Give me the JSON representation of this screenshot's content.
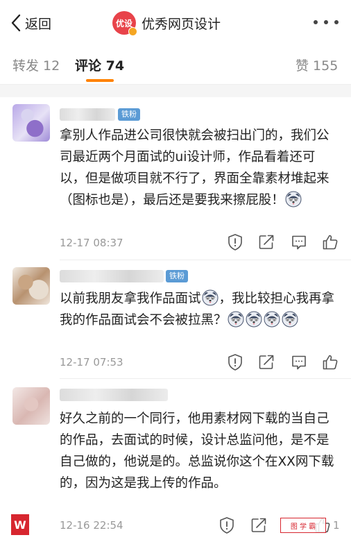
{
  "nav": {
    "back_label": "返回",
    "brand_logo_text": "优设",
    "brand_name": "优秀网页设计"
  },
  "tabs": [
    {
      "label": "转发 12"
    },
    {
      "label": "评论 74"
    },
    {
      "label": "赞 155"
    }
  ],
  "comments": [
    {
      "badge": "铁粉",
      "text": "拿别人作品进公司很快就会被扫出门的，我们公司最近两个月面试的ui设计师，作品看着还可以，但是做项目就不行了，界面全靠素材堆起来（图标也是），最后还是要我来擦屁股！",
      "time": "12-17 08:37"
    },
    {
      "badge": "铁粉",
      "text_a": "以前我朋友拿我作品面试",
      "text_b": "，我比较担心我再拿我的作品面试会不会被拉黑？",
      "time": "12-17 07:53"
    },
    {
      "text": "好久之前的一个同行，他用素材网下载的当自己的作品，去面试的时候，设计总监问他，是不是自己做的，他说是的。总监说你这个在XX网下载的，因为这是我上传的作品。",
      "time": "12-16 22:54",
      "like_count": "1"
    }
  ],
  "watermark": {
    "left_text": "W",
    "right_text": "图 学 霸"
  },
  "colors": {
    "accent_orange": "#ff8200",
    "fan_badge_blue": "#5b9bd5",
    "brand_red": "#e8434a"
  }
}
